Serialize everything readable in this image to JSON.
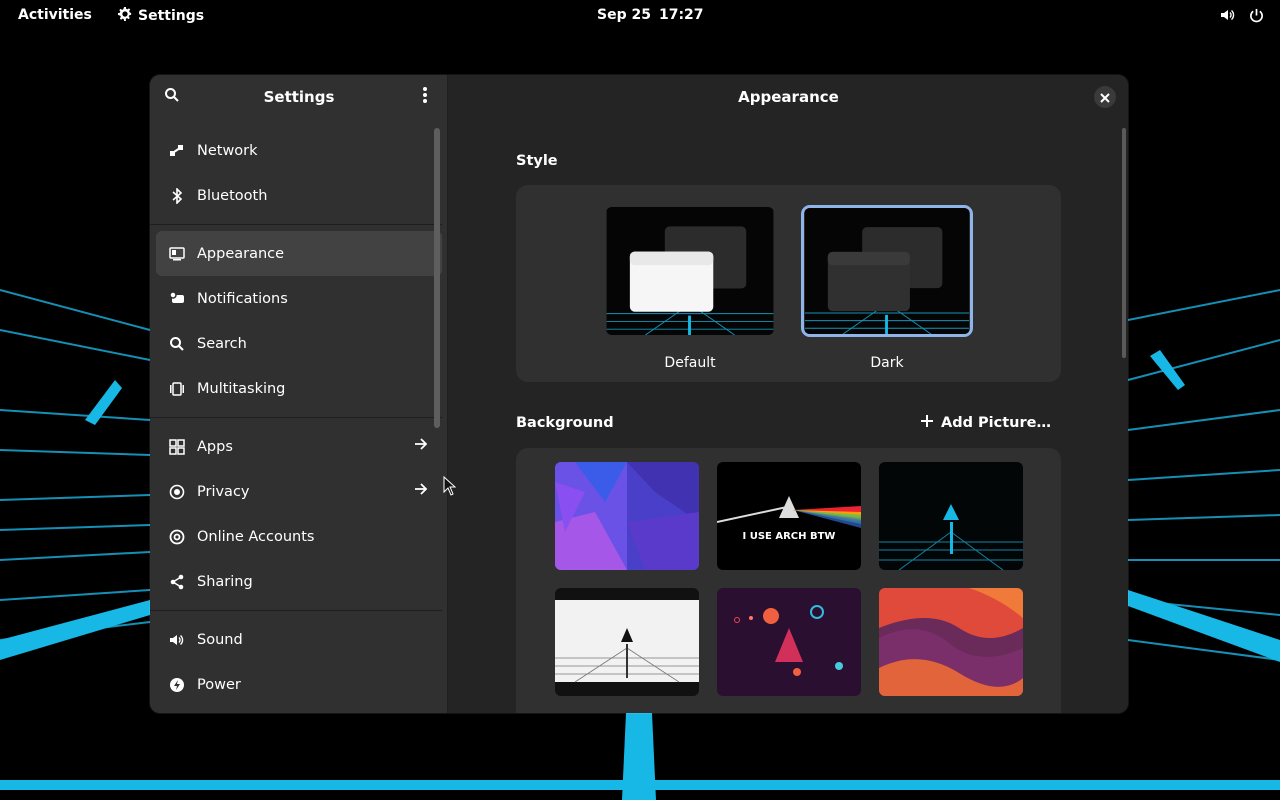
{
  "topbar": {
    "activities": "Activities",
    "app_name": "Settings",
    "date": "Sep 25",
    "time": "17:27",
    "icons": [
      "volume-icon",
      "power-icon"
    ]
  },
  "sidebar": {
    "title": "Settings",
    "items": [
      {
        "label": "Network",
        "icon": "network-icon"
      },
      {
        "label": "Bluetooth",
        "icon": "bluetooth-icon"
      },
      {
        "label": "Appearance",
        "icon": "appearance-icon",
        "selected": true
      },
      {
        "label": "Notifications",
        "icon": "notifications-icon"
      },
      {
        "label": "Search",
        "icon": "search-icon"
      },
      {
        "label": "Multitasking",
        "icon": "multitasking-icon"
      },
      {
        "label": "Apps",
        "icon": "apps-icon",
        "has_arrow": true
      },
      {
        "label": "Privacy",
        "icon": "privacy-icon",
        "has_arrow": true
      },
      {
        "label": "Online Accounts",
        "icon": "online-accounts-icon"
      },
      {
        "label": "Sharing",
        "icon": "sharing-icon"
      },
      {
        "label": "Sound",
        "icon": "sound-icon"
      },
      {
        "label": "Power",
        "icon": "power-icon"
      }
    ]
  },
  "content": {
    "title": "Appearance",
    "style_section": "Style",
    "style_options": [
      {
        "label": "Default",
        "selected": false
      },
      {
        "label": "Dark",
        "selected": true
      }
    ],
    "background_section": "Background",
    "add_picture": "Add Picture…",
    "backgrounds": [
      {
        "name": "purple-polygon-wallpaper"
      },
      {
        "name": "arch-prism-wallpaper",
        "caption": "I USE ARCH BTW"
      },
      {
        "name": "arch-neon-grid-wallpaper"
      },
      {
        "name": "arch-white-grid-wallpaper"
      },
      {
        "name": "arch-space-wallpaper"
      },
      {
        "name": "orange-waves-wallpaper"
      }
    ]
  },
  "colors": {
    "accent": "#8fb4ea",
    "neon": "#17b8e6",
    "window_bg": "#242424",
    "sidebar_bg": "#303030"
  }
}
